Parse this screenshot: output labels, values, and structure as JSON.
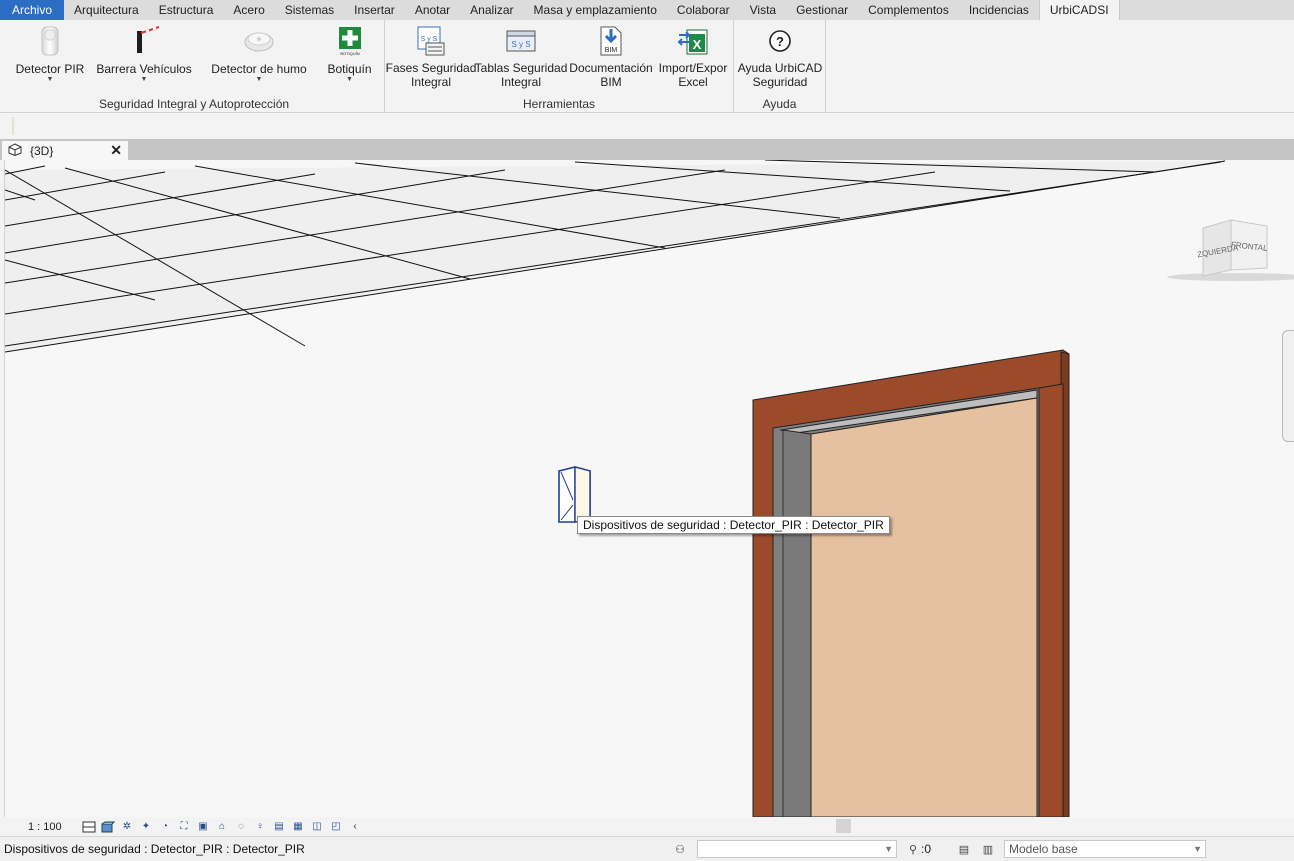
{
  "menu": {
    "tabs": [
      "Archivo",
      "Arquitectura",
      "Estructura",
      "Acero",
      "Sistemas",
      "Insertar",
      "Anotar",
      "Analizar",
      "Masa y emplazamiento",
      "Colaborar",
      "Vista",
      "Gestionar",
      "Complementos",
      "Incidencias",
      "UrbiCADSI"
    ],
    "active_tab": "UrbiCADSI"
  },
  "ribbon": {
    "panels": {
      "seguridad": "Seguridad Integral y Autoprotección",
      "herramientas": "Herramientas",
      "ayuda": "Ayuda"
    },
    "buttons": {
      "detector_pir": "Detector PIR",
      "barrera": "Barrera Vehículos",
      "detector_humo": "Detector de humo",
      "botiquin": "Botiquín",
      "botiquin_icon_text": "BOTIQUÍN",
      "fases_1": "Fases Seguridad",
      "fases_2": "Integral",
      "tablas_1": "Tablas Seguridad",
      "tablas_2": "Integral",
      "doc_1": "Documentación",
      "doc_2": "BIM",
      "doc_icon_text": "BIM",
      "import_1": "Import/Expor",
      "import_2": "Excel",
      "ayuda_1": "Ayuda UrbiCAD",
      "ayuda_2": "Seguridad",
      "sys_icon_text": "S y S"
    }
  },
  "view_tab": {
    "name": "{3D}"
  },
  "viewport": {
    "tooltip": "Dispositivos de seguridad : Detector_PIR : Detector_PIR",
    "viewcube_left": "IZQUIERDA",
    "viewcube_front": "FRONTAL"
  },
  "view_control": {
    "scale": "1 : 100"
  },
  "status": {
    "text": "Dispositivos de seguridad : Detector_PIR : Detector_PIR",
    "filter_count": ":0",
    "model": "Modelo base"
  },
  "colors": {
    "file_tab": "#2b6cc4",
    "door_frame": "#9b4a2a",
    "door_panel": "#e5c19f",
    "door_jamb": "#7a7a7a",
    "selection_blue": "#1f3f8f"
  }
}
